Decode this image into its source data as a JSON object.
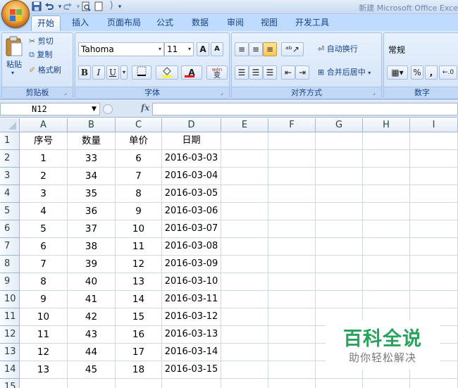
{
  "window": {
    "title": "新建 Microsoft Office Exce",
    "qat": [
      "save-icon",
      "undo-icon",
      "redo-icon",
      "print-preview-icon",
      "open-icon"
    ],
    "qat_overflow": "▾"
  },
  "tabs": [
    {
      "label": "开始",
      "active": true
    },
    {
      "label": "插入"
    },
    {
      "label": "页面布局"
    },
    {
      "label": "公式"
    },
    {
      "label": "数据"
    },
    {
      "label": "审阅"
    },
    {
      "label": "视图"
    },
    {
      "label": "开发工具"
    }
  ],
  "ribbon": {
    "clipboard": {
      "label": "剪贴板",
      "paste": "粘贴",
      "cut": "剪切",
      "copy": "复制",
      "format_painter": "格式刷"
    },
    "font": {
      "label": "字体",
      "name": "Tahoma",
      "size": "11",
      "grow": "A",
      "shrink": "A",
      "bold": "B",
      "italic": "I",
      "underline": "U",
      "wen": "wén",
      "wen_char": "变",
      "font_color": "#ff0000",
      "fill_color": "#ffff00"
    },
    "alignment": {
      "label": "对齐方式",
      "wrap": "自动换行",
      "merge": "合并后居中"
    },
    "number": {
      "label": "数字",
      "format": "常规",
      "percent": "%",
      "comma": ",",
      "decimal": ".0",
      "decimal_suffix": "0"
    }
  },
  "formula_bar": {
    "name_box": "N12",
    "fx": "fx",
    "formula": ""
  },
  "columns": [
    "A",
    "B",
    "C",
    "D",
    "E",
    "F",
    "G",
    "H",
    "I"
  ],
  "rows": [
    {
      "n": "1",
      "cells": [
        "序号",
        "数量",
        "单价",
        "日期"
      ]
    },
    {
      "n": "2",
      "cells": [
        "1",
        "33",
        "6",
        "2016-03-03"
      ]
    },
    {
      "n": "3",
      "cells": [
        "2",
        "34",
        "7",
        "2016-03-04"
      ]
    },
    {
      "n": "4",
      "cells": [
        "3",
        "35",
        "8",
        "2016-03-05"
      ]
    },
    {
      "n": "5",
      "cells": [
        "4",
        "36",
        "9",
        "2016-03-06"
      ]
    },
    {
      "n": "6",
      "cells": [
        "5",
        "37",
        "10",
        "2016-03-07"
      ]
    },
    {
      "n": "7",
      "cells": [
        "6",
        "38",
        "11",
        "2016-03-08"
      ]
    },
    {
      "n": "8",
      "cells": [
        "7",
        "39",
        "12",
        "2016-03-09"
      ]
    },
    {
      "n": "9",
      "cells": [
        "8",
        "40",
        "13",
        "2016-03-10"
      ]
    },
    {
      "n": "10",
      "cells": [
        "9",
        "41",
        "14",
        "2016-03-11"
      ]
    },
    {
      "n": "11",
      "cells": [
        "10",
        "42",
        "15",
        "2016-03-12"
      ]
    },
    {
      "n": "12",
      "cells": [
        "11",
        "43",
        "16",
        "2016-03-13"
      ]
    },
    {
      "n": "13",
      "cells": [
        "12",
        "44",
        "17",
        "2016-03-14"
      ]
    },
    {
      "n": "14",
      "cells": [
        "13",
        "45",
        "18",
        "2016-03-15"
      ]
    },
    {
      "n": "15",
      "cells": [
        "",
        "",
        "",
        ""
      ]
    }
  ],
  "watermark": {
    "title": "百科全说",
    "subtitle": "助你轻松解决",
    "color": "#27a35d"
  }
}
